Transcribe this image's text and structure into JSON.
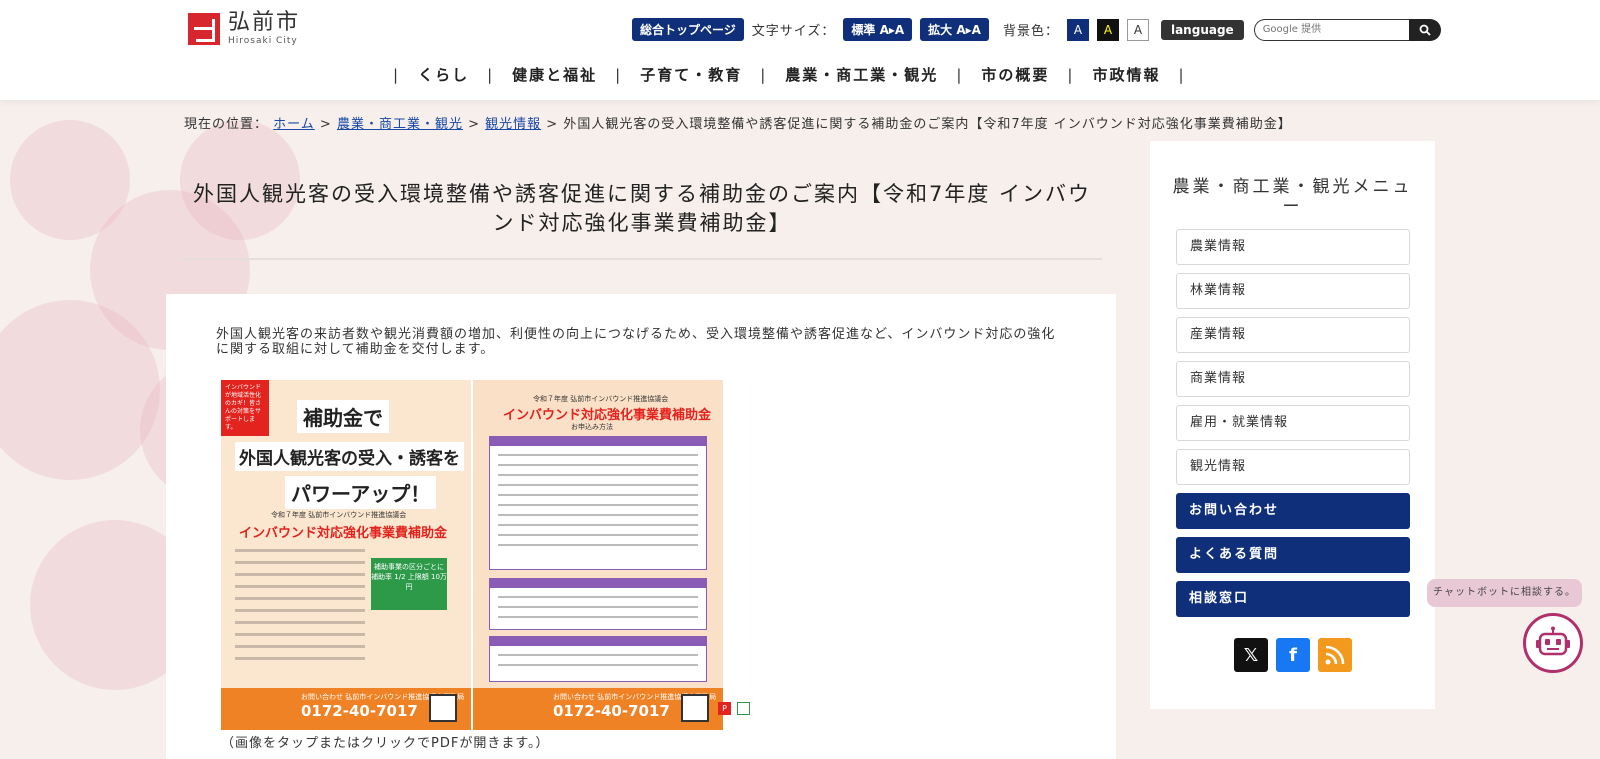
{
  "header": {
    "logo_jp": "弘前市",
    "logo_en": "Hirosaki City",
    "top_page": "総合トップページ",
    "font_size_label": "文字サイズ：",
    "font_standard": "標準 A▸A",
    "font_large": "拡大 A▸A",
    "bg_color_label": "背景色：",
    "bg_options": [
      "A",
      "A",
      "A"
    ],
    "language": "language",
    "search_placeholder": "Google 提供"
  },
  "nav": {
    "items": [
      "くらし",
      "健康と福祉",
      "子育て・教育",
      "農業・商工業・観光",
      "市の概要",
      "市政情報"
    ]
  },
  "breadcrumb": {
    "prefix": "現在の位置：",
    "links": [
      "ホーム",
      "農業・商工業・観光",
      "観光情報"
    ],
    "current": "外国人観光客の受入環境整備や誘客促進に関する補助金のご案内【令和7年度 インバウンド対応強化事業費補助金】"
  },
  "main": {
    "title": "外国人観光客の受入環境整備や誘客促進に関する補助金のご案内【令和7年度 インバウンド対応強化事業費補助金】",
    "lead": "外国人観光客の来訪者数や観光消費額の増加、利便性の向上につなげるため、受入環境整備や誘客促進など、インバウンド対応の強化に関する取組に対して補助金を交付します。",
    "caption": "（画像をタップまたはクリックでPDFが開きます。）",
    "flyer1": {
      "tag": "インバウンドが地域活性化のカギ！皆さんの対策をサポートします。",
      "h1": "補助金で",
      "h2": "外国人観光客の受入・誘客を",
      "h3": "パワーアップ！",
      "sub": "令和７年度 弘前市インバウンド推進協議会",
      "main": "インバウンド対応強化事業費補助金",
      "green": "補助事業の区分ごとに 補助率 1/2 上限額 10万円",
      "org": "お問い合わせ 弘前市インバウンド推進協議会事務局",
      "tel": "0172-40-7017"
    },
    "flyer2": {
      "top": "令和７年度 弘前市インバウンド推進協議会",
      "main": "インバウンド対応強化事業費補助金",
      "sub": "お申込み方法",
      "org": "お問い合わせ 弘前市インバウンド推進協議会事務局",
      "tel": "0172-40-7017"
    }
  },
  "sidebar": {
    "title": "農業・商工業・観光メニュー",
    "items": [
      "農業情報",
      "林業情報",
      "産業情報",
      "商業情報",
      "雇用・就業情報",
      "観光情報"
    ],
    "buttons": [
      "お問い合わせ",
      "よくある質問",
      "相談窓口"
    ]
  },
  "chatbot": {
    "label": "チャットボットに相談する。"
  },
  "colors": {
    "navy": "#0f2f7a",
    "red": "#d8262e",
    "orange": "#f08226"
  }
}
